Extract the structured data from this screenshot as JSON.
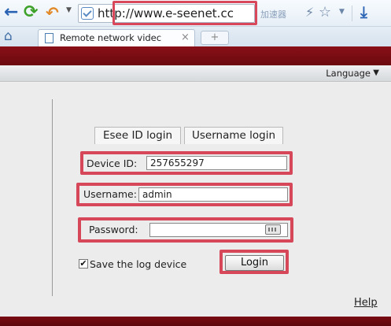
{
  "browser": {
    "address_url": "http://www.e-seenet.cc",
    "accelerator_label": "加速器",
    "tab_title": "Remote network videc",
    "tab_close": "×",
    "new_tab": "+"
  },
  "page": {
    "language_label": "Language",
    "language_arrow": "▼",
    "login_tabs": [
      "Esee ID login",
      "Username login"
    ],
    "device_id": {
      "label": "Device ID:",
      "value": "257655297"
    },
    "username": {
      "label": "Username:",
      "value": "admin"
    },
    "password": {
      "label": "Password:",
      "value": ""
    },
    "save_checkbox_mark": "✔",
    "save_label": "Save the log device",
    "login_button": "Login",
    "help_link": "Help"
  },
  "colors": {
    "highlight": "#d6475a",
    "banner": "#7a0c13"
  },
  "icons": [
    "back-arrow-icon",
    "refresh-icon",
    "undo-icon",
    "shield-icon",
    "lightning-icon",
    "star-icon",
    "download-icon",
    "home-icon",
    "document-icon",
    "keyboard-icon"
  ]
}
